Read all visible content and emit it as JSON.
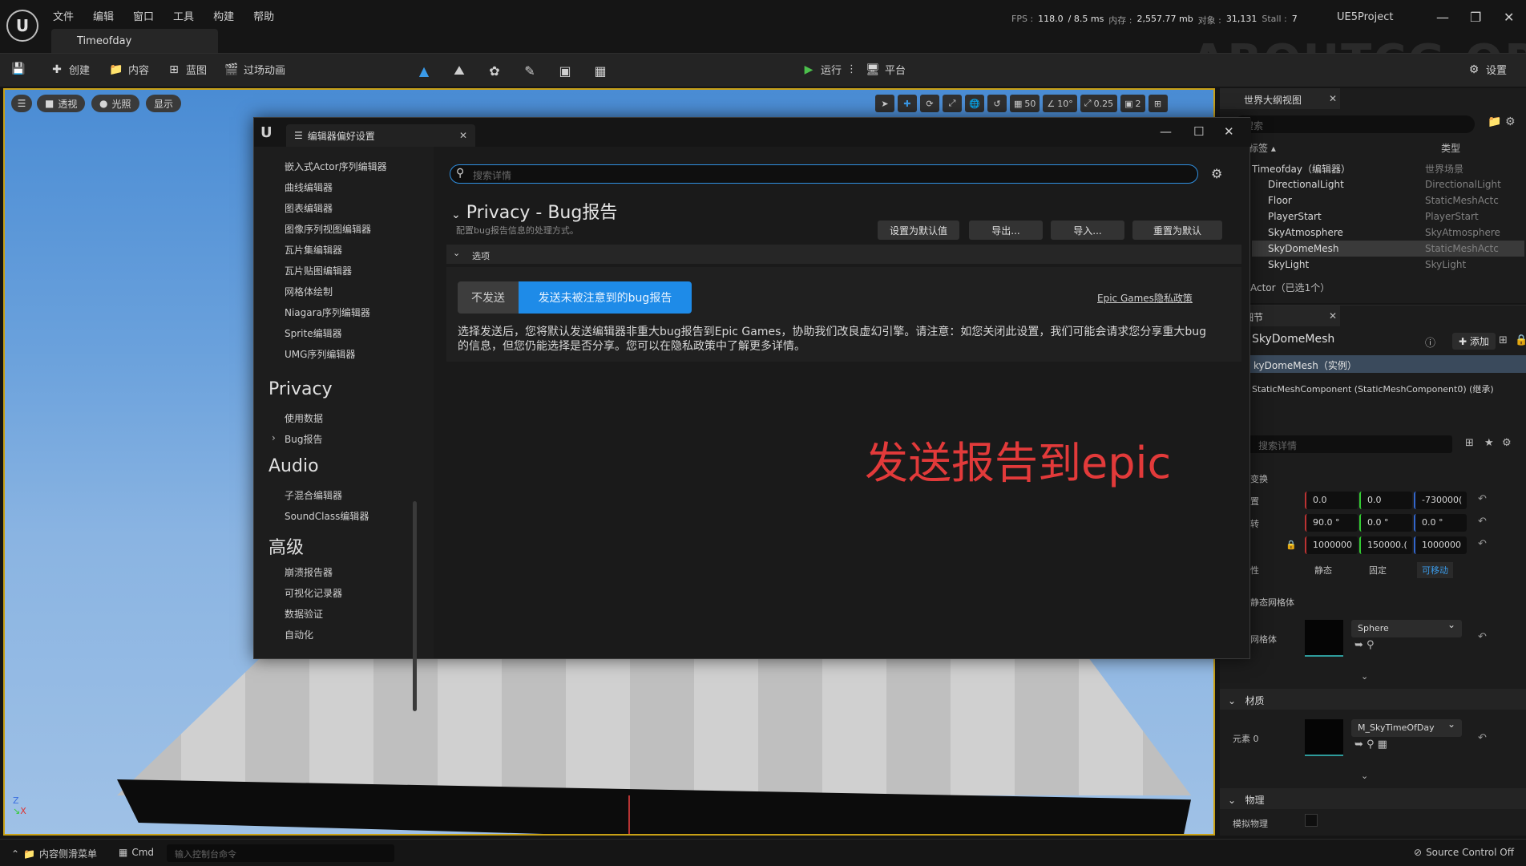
{
  "menubar": {
    "items": [
      "文件",
      "编辑",
      "窗口",
      "工具",
      "构建",
      "帮助"
    ],
    "level_tab": "Timeofday",
    "stats": {
      "fps_label": "FPS :",
      "fps": "118.0",
      "ms": "/ 8.5 ms",
      "mem_label": "内存 :",
      "mem": "2,557.77 mb",
      "obj_label": "对象 :",
      "obj": "31,131",
      "stall_label": "Stall :",
      "stall": "7"
    },
    "project": "UE5Project",
    "watermark": "ABOUTCG.ORG"
  },
  "toolbar": {
    "create": "创建",
    "content": "内容",
    "blueprint": "蓝图",
    "cinematics": "过场动画",
    "play": "运行",
    "platforms": "平台",
    "settings": "设置"
  },
  "viewport": {
    "perspective": "透视",
    "lit": "光照",
    "show": "显示",
    "grid": "50",
    "angle": "10°",
    "scale": "0.25",
    "camera": "2"
  },
  "outliner": {
    "tab": "世界大纲视图",
    "search_placeholder": "搜索",
    "col_label": "标签 ▴",
    "col_type": "类型",
    "rows": [
      {
        "label": "Timeofday（编辑器）",
        "type": "世界场景"
      },
      {
        "label": "DirectionalLight",
        "type": "DirectionalLight"
      },
      {
        "label": "Floor",
        "type": "StaticMeshActc"
      },
      {
        "label": "PlayerStart",
        "type": "PlayerStart"
      },
      {
        "label": "SkyAtmosphere",
        "type": "SkyAtmosphere"
      },
      {
        "label": "SkyDomeMesh",
        "type": "StaticMeshActc"
      },
      {
        "label": "SkyLight",
        "type": "SkyLight"
      }
    ],
    "actor_count": "Actor（已选1个）"
  },
  "details": {
    "tab": "细节",
    "object_name": "SkyDomeMesh",
    "add_label": "添加",
    "instance": "kyDomeMesh（实例）",
    "component": "StaticMeshComponent (StaticMeshComponent0) (继承)",
    "search_placeholder": "搜索详情",
    "transform_label": "变换",
    "loc_label": "置",
    "rot_label": "转",
    "location": [
      "0.0",
      "0.0",
      "-730000("
    ],
    "rotation": [
      "90.0 °",
      "0.0 °",
      "0.0 °"
    ],
    "scale": [
      "1000000",
      "150000.(",
      "1000000"
    ],
    "mobility_label": "性",
    "mobility": [
      "静态",
      "固定",
      "可移动"
    ],
    "static_mesh_section": "静态网格体",
    "mesh_label": "网格体",
    "mesh_value": "Sphere",
    "materials_section": "材质",
    "element_label": "元素 0",
    "material_value": "M_SkyTimeOfDay",
    "physics_section": "物理",
    "simulate_label": "模拟物理"
  },
  "statusbar": {
    "content_drawer": "内容侧滑菜单",
    "cmd": "Cmd",
    "cmd_placeholder": "输入控制台命令",
    "source_control": "Source Control Off"
  },
  "prefs": {
    "tab_title": "编辑器偏好设置",
    "nav_top_items": [
      "嵌入式Actor序列编辑器",
      "曲线编辑器",
      "图表编辑器",
      "图像序列视图编辑器",
      "瓦片集编辑器",
      "瓦片贴图编辑器",
      "网格体绘制",
      "Niagara序列编辑器",
      "Sprite编辑器",
      "UMG序列编辑器"
    ],
    "cat_privacy": "Privacy",
    "privacy_items": [
      "使用数据",
      "Bug报告"
    ],
    "cat_audio": "Audio",
    "audio_items": [
      "子混合编辑器",
      "SoundClass编辑器"
    ],
    "cat_advanced": "高级",
    "advanced_items": [
      "崩溃报告器",
      "可视化记录器",
      "数据验证",
      "自动化"
    ],
    "search_placeholder": "搜索详情",
    "title": "Privacy - Bug报告",
    "subtitle": "配置bug报告信息的处理方式。",
    "btn_set_default": "设置为默认值",
    "btn_export": "导出...",
    "btn_import": "导入...",
    "btn_reset": "重置为默认",
    "section": "选项",
    "opt_no_send": "不发送",
    "opt_send": "发送未被注意到的bug报告",
    "policy_link": "Epic Games隐私政策",
    "description": "选择发送后，您将默认发送编辑器非重大bug报告到Epic Games，协助我们改良虚幻引擎。请注意：如您关闭此设置，我们可能会请求您分享重大bug的信息，但您仍能选择是否分享。您可以在隐私政策中了解更多详情。",
    "annotation": "发送报告到epic"
  },
  "colors": {
    "accent_blue": "#1e8be8",
    "annotation_red": "#e23a3a",
    "selection_gold": "#c8a016"
  }
}
